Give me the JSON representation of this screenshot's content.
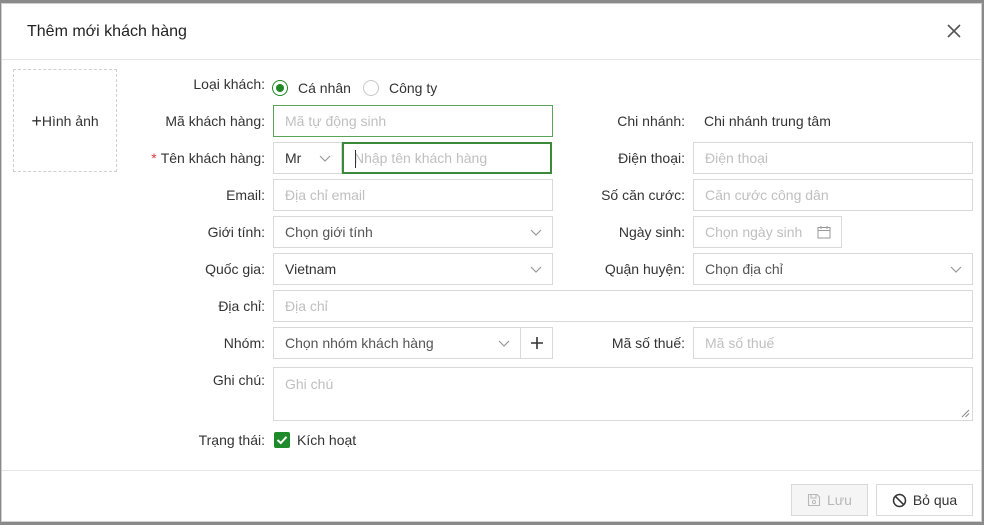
{
  "dialog": {
    "title": "Thêm mới khách hàng"
  },
  "image": {
    "label": "Hình ảnh",
    "plus": "+"
  },
  "customer_type": {
    "label": "Loại khách:",
    "options": [
      "Cá nhân",
      "Công ty"
    ],
    "selected": "Cá nhân"
  },
  "customer_code": {
    "label": "Mã khách hàng:",
    "placeholder": "Mã tự động sinh"
  },
  "branch": {
    "label": "Chi nhánh:",
    "value": "Chi nhánh trung tâm"
  },
  "customer_name": {
    "required_mark": "*",
    "label": "Tên khách hàng:",
    "title_value": "Mr",
    "placeholder": "Nhập tên khách hàng"
  },
  "phone": {
    "label": "Điện thoại:",
    "placeholder": "Điện thoại"
  },
  "email": {
    "label": "Email:",
    "placeholder": "Địa chỉ email"
  },
  "id_card": {
    "label": "Số căn cước:",
    "placeholder": "Căn cước công dân"
  },
  "gender": {
    "label": "Giới tính:",
    "placeholder": "Chọn giới tính"
  },
  "birthday": {
    "label": "Ngày sinh:",
    "placeholder": "Chọn ngày sinh"
  },
  "country": {
    "label": "Quốc gia:",
    "value": "Vietnam"
  },
  "district": {
    "label": "Quận huyện:",
    "placeholder": "Chọn địa chỉ"
  },
  "address": {
    "label": "Địa chỉ:",
    "placeholder": "Địa chỉ"
  },
  "group": {
    "label": "Nhóm:",
    "placeholder": "Chọn nhóm khách hàng"
  },
  "tax_code": {
    "label": "Mã số thuế:",
    "placeholder": "Mã số thuế"
  },
  "note": {
    "label": "Ghi chú:",
    "placeholder": "Ghi chú"
  },
  "status": {
    "label": "Trạng thái:",
    "checkbox_label": "Kích hoạt",
    "checked": true
  },
  "footer": {
    "save_label": "Lưu",
    "cancel_label": "Bỏ qua"
  },
  "colors": {
    "accent": "#1f8a2a",
    "focus_border": "#5aa45a",
    "required": "#d9363e"
  }
}
